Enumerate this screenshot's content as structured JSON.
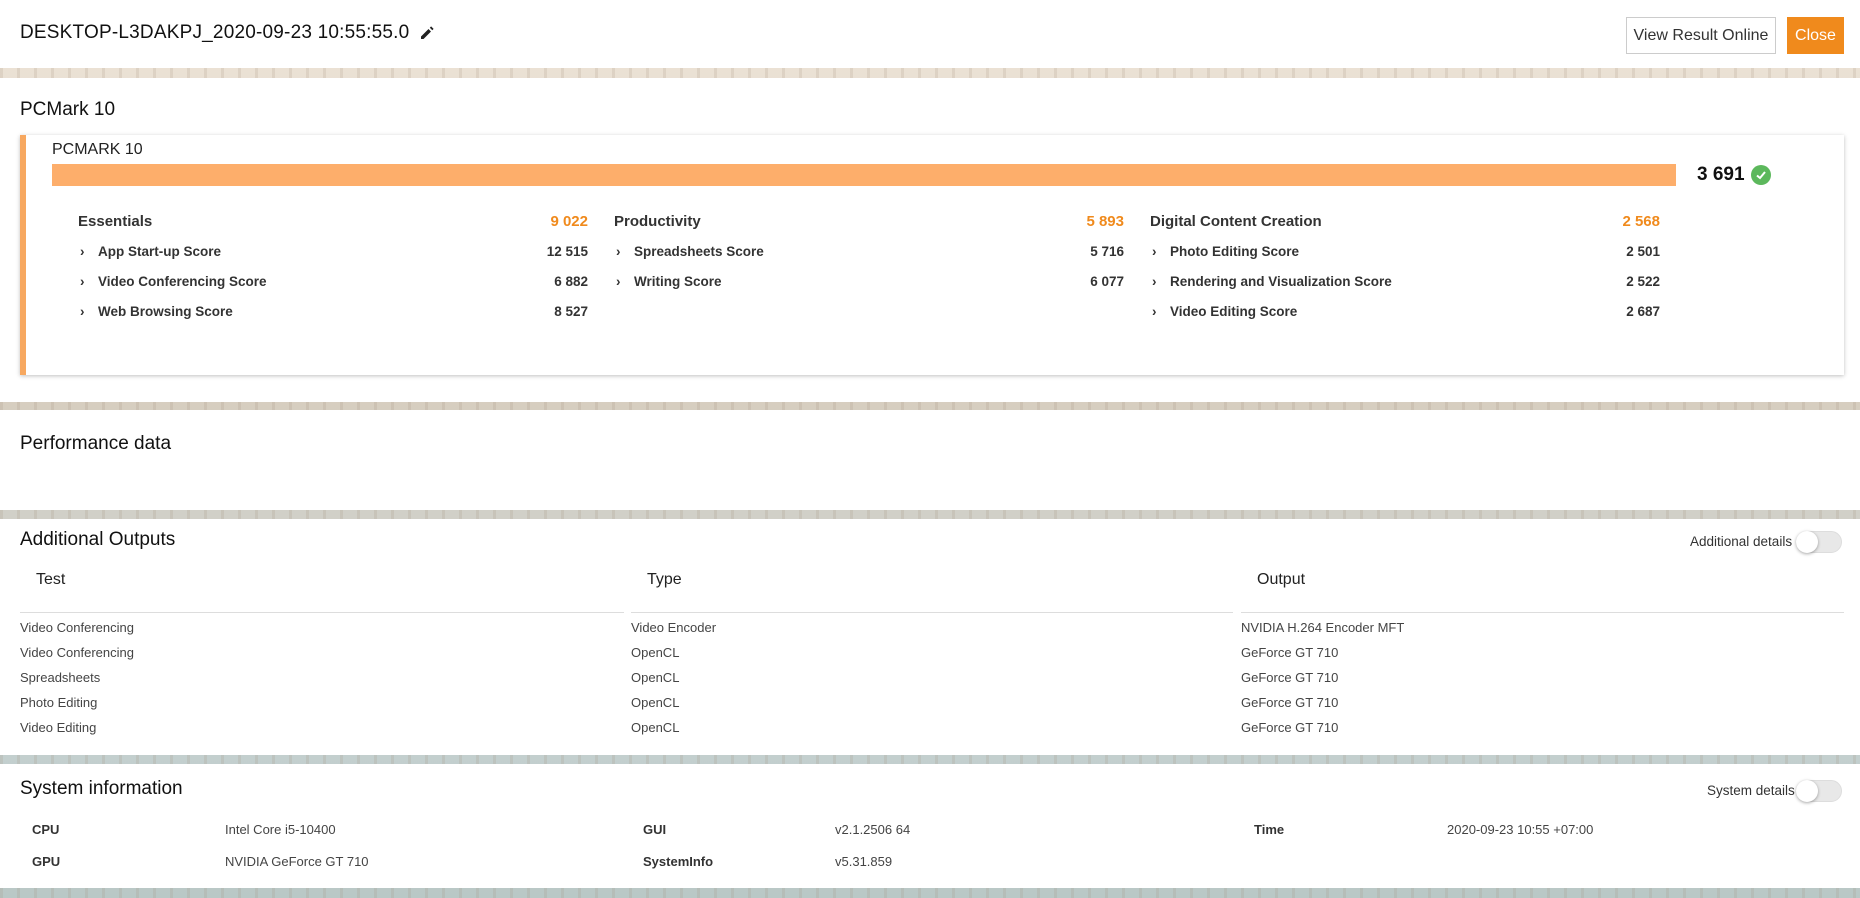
{
  "header": {
    "title": "DESKTOP-L3DAKPJ_2020-09-23 10:55:55.0",
    "view_online_label": "View Result Online",
    "close_label": "Close"
  },
  "benchmark": {
    "section_title": "PCMark 10",
    "card_name": "PCMARK 10",
    "total_score": "3 691",
    "status_icon": "check-circle-icon",
    "bar_color": "#fdae6b",
    "accent_color": "#f08a1c",
    "groups": [
      {
        "name": "Essentials",
        "score": "9 022",
        "tests": [
          {
            "label": "App Start-up Score",
            "value": "12 515"
          },
          {
            "label": "Video Conferencing Score",
            "value": "6 882"
          },
          {
            "label": "Web Browsing Score",
            "value": "8 527"
          }
        ]
      },
      {
        "name": "Productivity",
        "score": "5 893",
        "tests": [
          {
            "label": "Spreadsheets Score",
            "value": "5 716"
          },
          {
            "label": "Writing Score",
            "value": "6 077"
          }
        ]
      },
      {
        "name": "Digital Content Creation",
        "score": "2 568",
        "tests": [
          {
            "label": "Photo Editing Score",
            "value": "2 501"
          },
          {
            "label": "Rendering and Visualization Score",
            "value": "2 522"
          },
          {
            "label": "Video Editing Score",
            "value": "2 687"
          }
        ]
      }
    ]
  },
  "performance": {
    "title": "Performance data"
  },
  "outputs": {
    "title": "Additional Outputs",
    "toggle_label": "Additional details",
    "columns": [
      "Test",
      "Type",
      "Output"
    ],
    "rows": [
      [
        "Video Conferencing",
        "Video Encoder",
        "NVIDIA H.264 Encoder MFT"
      ],
      [
        "Video Conferencing",
        "OpenCL",
        "GeForce GT 710"
      ],
      [
        "Spreadsheets",
        "OpenCL",
        "GeForce GT 710"
      ],
      [
        "Photo Editing",
        "OpenCL",
        "GeForce GT 710"
      ],
      [
        "Video Editing",
        "OpenCL",
        "GeForce GT 710"
      ]
    ]
  },
  "system": {
    "title": "System information",
    "toggle_label": "System details",
    "items": [
      {
        "key": "CPU",
        "value": "Intel Core i5-10400"
      },
      {
        "key": "GPU",
        "value": "NVIDIA GeForce GT 710"
      },
      {
        "key": "GUI",
        "value": "v2.1.2506 64"
      },
      {
        "key": "SystemInfo",
        "value": "v5.31.859"
      },
      {
        "key": "Time",
        "value": "2020-09-23 10:55 +07:00"
      }
    ]
  }
}
